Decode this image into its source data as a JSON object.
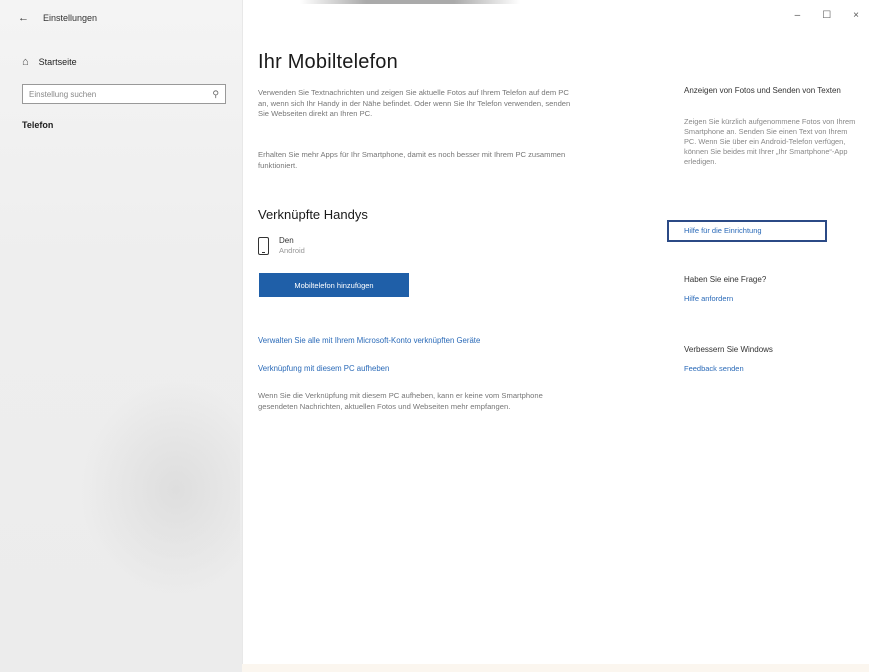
{
  "window": {
    "title": "Einstellungen",
    "controls": {
      "minimize": "–",
      "maximize": "☐",
      "close": "×"
    }
  },
  "sidebar": {
    "home_label": "Startseite",
    "search_placeholder": "Einstellung suchen",
    "active_item": "Telefon"
  },
  "main": {
    "title": "Ihr Mobiltelefon",
    "intro_paragraph": "Verwenden Sie Textnachrichten und zeigen Sie aktuelle Fotos auf Ihrem Telefon auf dem PC an, wenn sich Ihr Handy in der Nähe befindet. Oder wenn Sie Ihr Telefon verwenden, senden Sie Webseiten direkt an Ihren PC.",
    "apps_paragraph": "Erhalten Sie mehr Apps für Ihr Smartphone, damit es noch besser mit Ihrem PC zusammen funktioniert.",
    "linked_heading": "Verknüpfte Handys",
    "device": {
      "name": "Den",
      "os": "Android"
    },
    "add_button_label": "Mobiltelefon hinzufügen",
    "manage_link": "Verwalten Sie alle mit Ihrem Microsoft-Konto verknüpften Geräte",
    "unlink_link": "Verknüpfung mit diesem PC aufheben",
    "unlink_paragraph": "Wenn Sie die Verknüpfung mit diesem PC aufheben, kann er keine vom Smartphone gesendeten Nachrichten, aktuellen Fotos und Webseiten mehr empfangen."
  },
  "right_panel": {
    "photos_heading": "Anzeigen von Fotos und Senden von Texten",
    "photos_paragraph": "Zeigen Sie kürzlich aufgenommene Fotos von Ihrem Smartphone an. Senden Sie einen Text von Ihrem PC. Wenn Sie über ein Android-Telefon verfügen, können Sie beides mit Ihrer „Ihr Smartphone“-App erledigen.",
    "setup_help_link": "Hilfe für die Einrichtung",
    "question_heading": "Haben Sie eine Frage?",
    "get_help_link": "Hilfe anfordern",
    "improve_heading": "Verbessern Sie Windows",
    "feedback_link": "Feedback senden"
  },
  "colors": {
    "accent": "#1f5fa8",
    "link": "#2a6ab8",
    "highlight": "#2b4a86"
  }
}
